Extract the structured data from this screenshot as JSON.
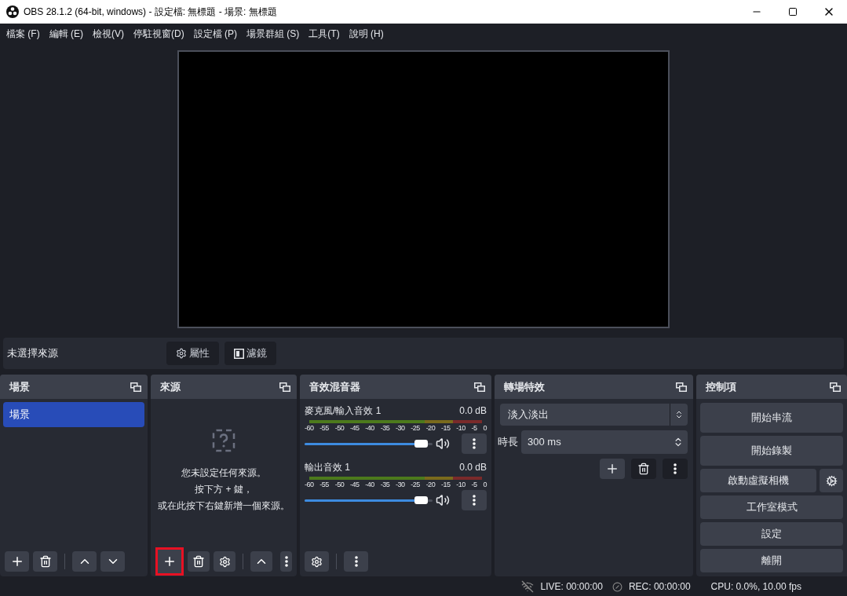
{
  "title_bar": {
    "title": "OBS 28.1.2 (64-bit, windows) - 設定檔: 無標題 - 場景: 無標題"
  },
  "menu": [
    "檔案 (F)",
    "編輯 (E)",
    "檢視(V)",
    "停駐視窗(D)",
    "設定檔 (P)",
    "場景群組 (S)",
    "工具(T)",
    "說明 (H)"
  ],
  "source_toolbar": {
    "label": "未選擇來源",
    "buttons": [
      {
        "kind": "properties",
        "label": "屬性"
      },
      {
        "kind": "filters",
        "label": "濾鏡"
      }
    ]
  },
  "scenes": {
    "title": "場景",
    "items": [
      {
        "label": "場景",
        "selected": true
      }
    ],
    "toolbar": [
      {
        "kind": "add",
        "highlighted": false
      },
      {
        "kind": "remove",
        "highlighted": false
      },
      {
        "kind": "separator"
      },
      {
        "kind": "up",
        "highlighted": false
      },
      {
        "kind": "down",
        "highlighted": false
      }
    ]
  },
  "sources": {
    "title": "來源",
    "empty_lines": [
      "您未設定任何來源。",
      "按下方 + 鍵，",
      "或在此按下右鍵新增一個來源。"
    ],
    "toolbar": [
      {
        "kind": "add",
        "highlighted": true
      },
      {
        "kind": "remove",
        "highlighted": false
      },
      {
        "kind": "settings",
        "highlighted": false
      },
      {
        "kind": "separator"
      },
      {
        "kind": "up",
        "highlighted": false
      },
      {
        "kind": "spacer"
      },
      {
        "kind": "more",
        "highlighted": false
      }
    ]
  },
  "mixer": {
    "title": "音效混音器",
    "channels": [
      {
        "name": "麥克風/輸入音效 1",
        "reading": "0.0 dB",
        "level": 0.93,
        "muted": false,
        "scale": [
          "-60",
          "-55",
          "-50",
          "-45",
          "-40",
          "-35",
          "-30",
          "-25",
          "-20",
          "-15",
          "-10",
          "-5",
          "0"
        ]
      },
      {
        "name": "輸出音效 1",
        "reading": "0.0 dB",
        "level": 0.93,
        "muted": false,
        "scale": [
          "-60",
          "-55",
          "-50",
          "-45",
          "-40",
          "-35",
          "-30",
          "-25",
          "-20",
          "-15",
          "-10",
          "-5",
          "0"
        ]
      }
    ],
    "toolbar": [
      {
        "kind": "settings",
        "highlighted": false
      },
      {
        "kind": "separator"
      },
      {
        "kind": "more",
        "highlighted": false
      }
    ]
  },
  "transitions": {
    "title": "轉場特效",
    "selected_transition": "淡入淡出",
    "duration_label": "時長",
    "duration": "300 ms"
  },
  "controls": {
    "title": "控制項",
    "buttons": [
      {
        "label": "開始串流",
        "kind": "plain"
      },
      {
        "label": "開始錄製",
        "kind": "plain"
      },
      {
        "label": "啟動虛擬相機",
        "kind": "with_gear"
      },
      {
        "label": "工作室模式",
        "kind": "plain"
      },
      {
        "label": "設定",
        "kind": "plain"
      },
      {
        "label": "離開",
        "kind": "plain"
      }
    ]
  },
  "status_bar": {
    "live": "LIVE: 00:00:00",
    "rec": "REC: 00:00:00",
    "cpu": "CPU: 0.0%, 10.00 fps"
  }
}
